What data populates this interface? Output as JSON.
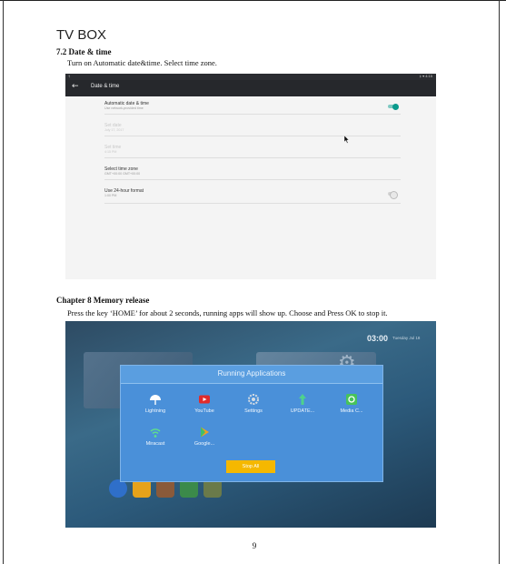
{
  "document": {
    "header_title": "TV BOX",
    "page_number": "9"
  },
  "section_date_time": {
    "heading": "7.2 Date & time",
    "body": "Turn on Automatic date&time. Select time zone."
  },
  "settings_screen": {
    "status_left": "†",
    "status_right": "‡ ▾ 4:15",
    "title": "Date & time",
    "rows": [
      {
        "title": "Automatic date & time",
        "subtitle": "Use network-provided time"
      },
      {
        "title": "Set date",
        "subtitle": "July 17, 2017"
      },
      {
        "title": "Set time",
        "subtitle": "4:15 PM"
      },
      {
        "title": "Select time zone",
        "subtitle": "GMT+00:00 GMT+00:00"
      },
      {
        "title": "Use 24-hour format",
        "subtitle": "1:00 PM"
      }
    ],
    "automatic_toggle_on": true,
    "format_24h_toggle_on": false
  },
  "section_memory": {
    "heading": "Chapter 8 Memory release",
    "body": "Press the key ‘HOME’ for about 2 seconds, running apps will show up. Choose and Press OK to stop it."
  },
  "running_apps_screen": {
    "clock": "03:00",
    "date": "Tuesday Jul 18",
    "dialog_title": "Running Applications",
    "apps": [
      {
        "label": "Lightning",
        "icon": "lightning-icon",
        "color": "#ffffff"
      },
      {
        "label": "YouTube",
        "icon": "youtube-icon",
        "color": "#e02b2b"
      },
      {
        "label": "Settings",
        "icon": "settings-gear-icon",
        "color": "#d7dde3"
      },
      {
        "label": "UPDATE...",
        "icon": "update-icon",
        "color": "#4fd28c"
      },
      {
        "label": "Media C...",
        "icon": "media-center-icon",
        "color": "#47c35a"
      },
      {
        "label": "Miracast",
        "icon": "miracast-icon",
        "color": "#5fe08a"
      },
      {
        "label": "Google...",
        "icon": "google-play-icon",
        "color": "#f0a020"
      }
    ],
    "stop_all_label": "Stop All",
    "accent_color": "#f5b800"
  }
}
